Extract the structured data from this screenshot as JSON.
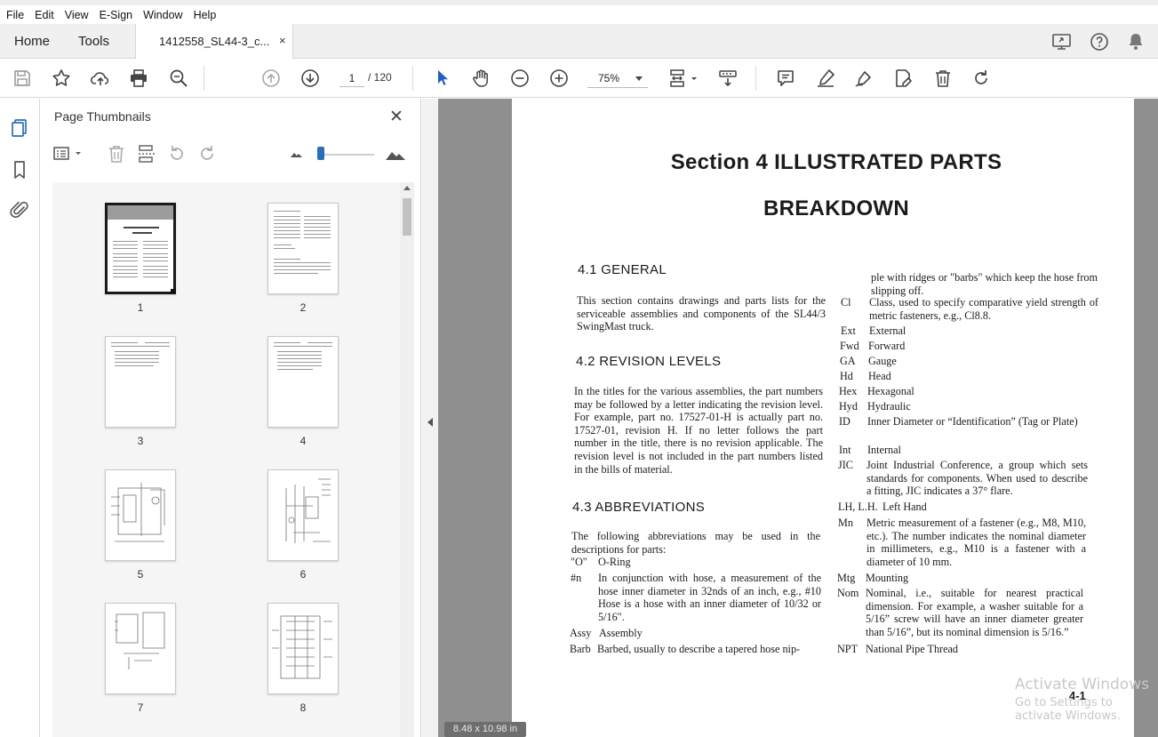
{
  "menu": [
    "File",
    "Edit",
    "View",
    "E-Sign",
    "Window",
    "Help"
  ],
  "tabs": {
    "home": "Home",
    "tools": "Tools",
    "document": "1412558_SL44-3_c...",
    "close": "×"
  },
  "toolbar": {
    "page_current": "1",
    "page_total": "/ 120",
    "zoom": "75%"
  },
  "thumbnails_panel": {
    "title": "Page Thumbnails",
    "close": "✕",
    "pages": [
      "1",
      "2",
      "3",
      "4",
      "5",
      "6",
      "7",
      "8"
    ],
    "selected_page": "1"
  },
  "document": {
    "title_line1": "Section 4 ILLUSTRATED PARTS",
    "title_line2": "BREAKDOWN",
    "s41_heading": "4.1 GENERAL",
    "s41_text": "This section contains drawings and parts lists for the serviceable assemblies and components of the SL44/3 SwingMast truck.",
    "s42_heading": "4.2 REVISION LEVELS",
    "s42_text": "In the titles for the various assemblies, the part numbers may be followed by a letter indicating the revision level. For example, part no. 17527-01-H is actually part no. 17527-01, revision H. If no letter follows the part number in the title, there is no revision applicable. The revision level is not included in the part numbers listed in the bills of material.",
    "s43_heading": "4.3 ABBREVIATIONS",
    "s43_text": "The following abbreviations may be used in the descriptions for parts:",
    "abbreviations_left": [
      {
        "key": "\"O\"",
        "value": "O-Ring"
      },
      {
        "key": "#n",
        "value": "In conjunction with hose, a measurement of the hose inner diameter in 32nds of an inch, e.g., #10 Hose is a hose with an inner diameter of 10/32 or 5/16\"."
      },
      {
        "key": "Assy",
        "value": "Assembly"
      },
      {
        "key": "Barb",
        "value": "Barbed, usually to describe a tapered hose nip-"
      }
    ],
    "barb_continued": "ple with ridges or \"barbs\" which keep the hose from slipping off.",
    "abbreviations_right": [
      {
        "key": "Cl",
        "value": "Class, used to specify comparative yield strength of metric fasteners, e.g., Cl8.8."
      },
      {
        "key": "Ext",
        "value": "External"
      },
      {
        "key": "Fwd",
        "value": "Forward"
      },
      {
        "key": "GA",
        "value": "Gauge"
      },
      {
        "key": "Hd",
        "value": "Head"
      },
      {
        "key": "Hex",
        "value": "Hexagonal"
      },
      {
        "key": "Hyd",
        "value": "Hydraulic"
      },
      {
        "key": "ID",
        "value": "Inner Diameter or “Identification” (Tag or Plate)"
      },
      {
        "key": "Int",
        "value": "Internal"
      },
      {
        "key": "JIC",
        "value": "Joint Industrial Conference, a group which sets standards for components. When used to describe a fitting, JIC indicates a 37° flare."
      },
      {
        "key": "LH, L.H.",
        "value": "Left Hand"
      },
      {
        "key": "Mn",
        "value": "Metric measurement of a fastener (e.g., M8, M10, etc.). The number indicates the nominal diameter in millimeters, e.g., M10 is a fastener with a diameter of 10 mm."
      },
      {
        "key": "Mtg",
        "value": "Mounting"
      },
      {
        "key": "Nom",
        "value": "Nominal, i.e., suitable for nearest practical dimension. For example, a washer suitable for a 5/16” screw will have an inner diameter greater than 5/16”, but its nominal dimension is 5/16.”"
      },
      {
        "key": "NPT",
        "value": "National Pipe Thread"
      }
    ],
    "page_number": "4-1"
  },
  "page_size_label": "8.48 x 10.98 in",
  "watermark": {
    "line1": "Activate Windows",
    "line2": "Go to Settings to activate Windows."
  },
  "colors": {
    "accent": "#2a6ebb",
    "doc_background": "#8f8f8f",
    "select_tool": "#1f5fbf"
  }
}
